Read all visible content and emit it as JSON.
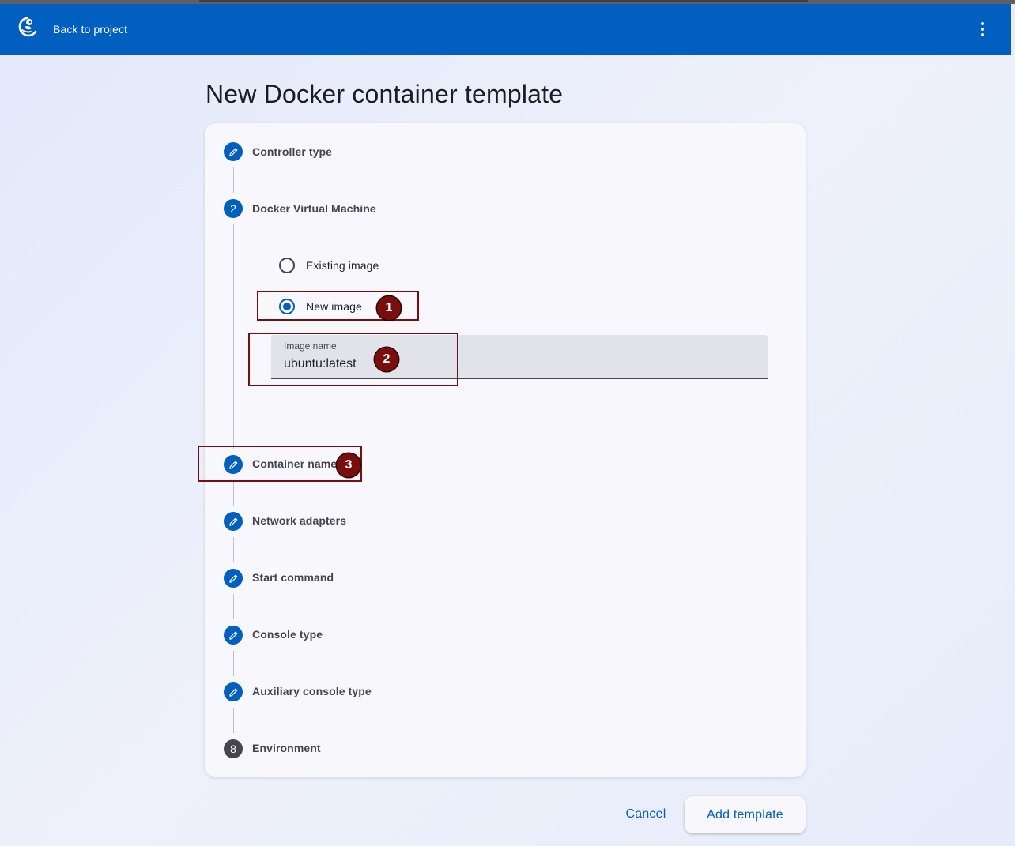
{
  "header": {
    "back_label": "Back to project",
    "brand_color": "#005fbf"
  },
  "page": {
    "title": "New Docker container template"
  },
  "stepper": {
    "steps": [
      {
        "label": "Controller type",
        "icon": "edit-icon"
      },
      {
        "label": "Docker Virtual Machine",
        "number": "2"
      },
      {
        "label": "Container name",
        "icon": "edit-icon"
      },
      {
        "label": "Network adapters",
        "icon": "edit-icon"
      },
      {
        "label": "Start command",
        "icon": "edit-icon"
      },
      {
        "label": "Console type",
        "icon": "edit-icon"
      },
      {
        "label": "Auxiliary console type",
        "icon": "edit-icon"
      },
      {
        "label": "Environment",
        "number": "8"
      }
    ]
  },
  "image_source": {
    "options": [
      {
        "label": "Existing image",
        "selected": false
      },
      {
        "label": "New image",
        "selected": true
      }
    ],
    "image_name_label": "Image name",
    "image_name_value": "ubuntu:latest"
  },
  "actions": {
    "cancel_label": "Cancel",
    "add_label": "Add template"
  },
  "annotations": {
    "color": "#7a0d0d",
    "badges": [
      "1",
      "2",
      "3"
    ]
  }
}
